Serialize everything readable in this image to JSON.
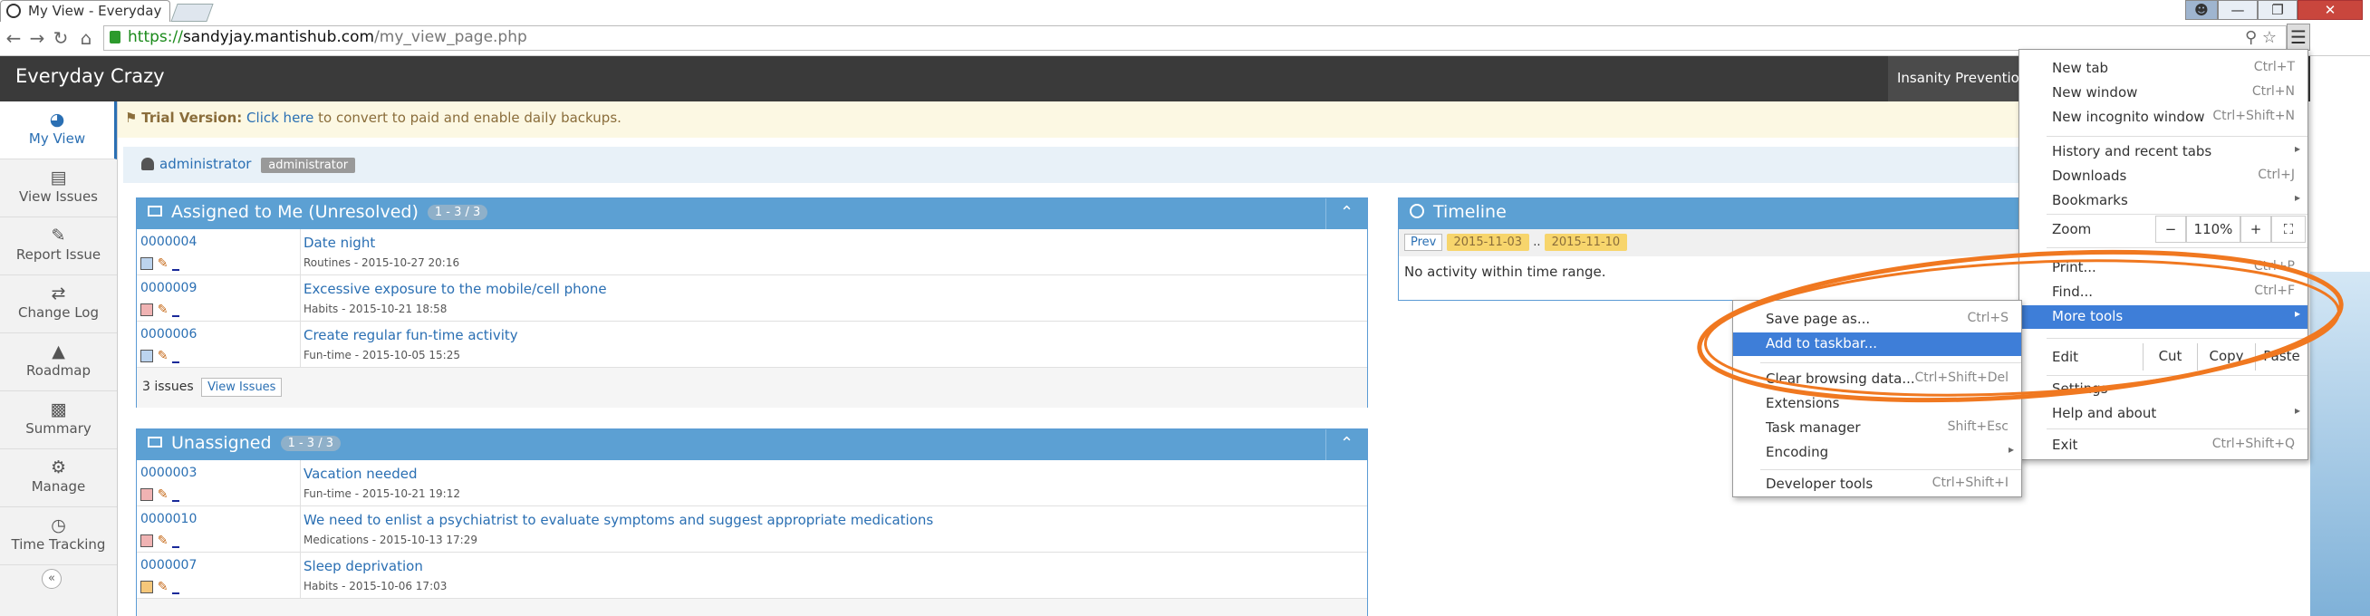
{
  "browser": {
    "tab_title": "My View - Everyday",
    "url_scheme": "https://",
    "url_host": "sandyjay.mantishub.com",
    "url_path": "/my_view_page.php"
  },
  "app": {
    "title": "Everyday Crazy",
    "project_button": "Insanity Prevention"
  },
  "sidebar": {
    "items": [
      {
        "label": "My View",
        "icon": "dashboard-icon"
      },
      {
        "label": "View Issues",
        "icon": "list-icon"
      },
      {
        "label": "Report Issue",
        "icon": "edit-icon"
      },
      {
        "label": "Change Log",
        "icon": "refresh-icon"
      },
      {
        "label": "Roadmap",
        "icon": "road-icon"
      },
      {
        "label": "Summary",
        "icon": "bar-chart-icon"
      },
      {
        "label": "Manage",
        "icon": "gears-icon"
      },
      {
        "label": "Time Tracking",
        "icon": "clock-icon"
      }
    ],
    "collapse_glyph": "«"
  },
  "trial": {
    "label": "Trial Version:",
    "link": "Click here",
    "rest": " to convert to paid and enable daily backups."
  },
  "user": {
    "name": "administrator",
    "role": "administrator"
  },
  "assigned": {
    "title": "Assigned to Me (Unresolved)",
    "count": "1 - 3 / 3",
    "rows": [
      {
        "id": "0000004",
        "title": "Date night",
        "meta": "Routines - 2015-10-27 20:16",
        "sev": "#bcd4ee"
      },
      {
        "id": "0000009",
        "title": "Excessive exposure to the mobile/cell phone",
        "meta": "Habits - 2015-10-21 18:58",
        "sev": "#f0b3b3"
      },
      {
        "id": "0000006",
        "title": "Create regular fun-time activity",
        "meta": "Fun-time - 2015-10-05 15:25",
        "sev": "#bcd4ee"
      }
    ],
    "footer": "3 issues",
    "view_issues": "View Issues"
  },
  "unassigned": {
    "title": "Unassigned",
    "count": "1 - 3 / 3",
    "rows": [
      {
        "id": "0000003",
        "title": "Vacation needed",
        "meta": "Fun-time - 2015-10-21 19:12",
        "sev": "#f0b3b3"
      },
      {
        "id": "0000010",
        "title": "We need to enlist a psychiatrist to evaluate symptoms and suggest appropriate medications",
        "meta": "Medications - 2015-10-13 17:29",
        "sev": "#f0b3b3"
      },
      {
        "id": "0000007",
        "title": "Sleep deprivation",
        "meta": "Habits - 2015-10-06 17:03",
        "sev": "#f5c77a"
      }
    ]
  },
  "timeline": {
    "title": "Timeline",
    "prev": "Prev",
    "date_from": "2015-11-03",
    "separator": "..",
    "date_to": "2015-11-10",
    "empty": "No activity within time range."
  },
  "chrome_menu": {
    "new_tab": {
      "label": "New tab",
      "shortcut": "Ctrl+T"
    },
    "new_window": {
      "label": "New window",
      "shortcut": "Ctrl+N"
    },
    "new_incognito": {
      "label": "New incognito window",
      "shortcut": "Ctrl+Shift+N"
    },
    "history": {
      "label": "History and recent tabs"
    },
    "downloads": {
      "label": "Downloads",
      "shortcut": "Ctrl+J"
    },
    "bookmarks": {
      "label": "Bookmarks"
    },
    "zoom": {
      "label": "Zoom",
      "minus": "−",
      "value": "110%",
      "plus": "+"
    },
    "print": {
      "label": "Print...",
      "shortcut": "Ctrl+P"
    },
    "find": {
      "label": "Find...",
      "shortcut": "Ctrl+F"
    },
    "more_tools": {
      "label": "More tools"
    },
    "edit": {
      "label": "Edit",
      "cut": "Cut",
      "copy": "Copy",
      "paste": "Paste"
    },
    "settings": {
      "label": "Settings"
    },
    "help": {
      "label": "Help and about"
    },
    "exit": {
      "label": "Exit",
      "shortcut": "Ctrl+Shift+Q"
    }
  },
  "more_tools_menu": {
    "save_page": {
      "label": "Save page as...",
      "shortcut": "Ctrl+S"
    },
    "add_taskbar": {
      "label": "Add to taskbar..."
    },
    "clear_data": {
      "label": "Clear browsing data...",
      "shortcut": "Ctrl+Shift+Del"
    },
    "extensions": {
      "label": "Extensions"
    },
    "task_manager": {
      "label": "Task manager",
      "shortcut": "Shift+Esc"
    },
    "encoding": {
      "label": "Encoding"
    },
    "dev_tools": {
      "label": "Developer tools",
      "shortcut": "Ctrl+Shift+I"
    }
  },
  "colors": {
    "header_bg": "#3a3a3a",
    "panel_blue": "#5ca0d3",
    "menu_highlight": "#3e7ed8",
    "annotation": "#f07820"
  }
}
